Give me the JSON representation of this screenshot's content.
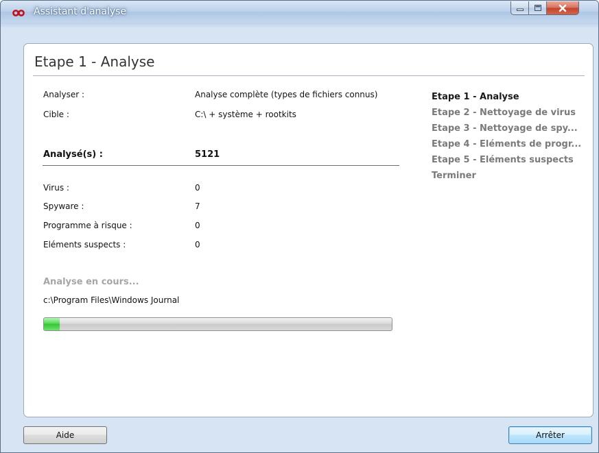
{
  "window": {
    "title": "Assistant d'analyse"
  },
  "icons": {
    "app_logo": "infinity-logo-icon",
    "minimize": "minimize-icon",
    "maximize": "maximize-icon",
    "close": "close-icon"
  },
  "colors": {
    "logo": "#c0101a",
    "progress": "#44cc44",
    "close_button": "#c8452c"
  },
  "main": {
    "heading": "Etape 1 - Analyse",
    "scan_label": "Analyser :",
    "scan_value": "Analyse complète (types de fichiers connus)",
    "target_label": "Cible :",
    "target_value": "C:\\  + système + rootkits",
    "scanned_label": "Analysé(s) :",
    "scanned_value": "5121",
    "results": [
      {
        "label": "Virus :",
        "value": "0"
      },
      {
        "label": "Spyware :",
        "value": "7"
      },
      {
        "label": "Programme à risque :",
        "value": "0"
      },
      {
        "label": "Eléments suspects :",
        "value": "0"
      }
    ],
    "status": "Analyse en cours...",
    "current_path": "c:\\Program Files\\Windows Journal",
    "progress_fraction": 0.045
  },
  "steps": [
    "Etape 1 - Analyse",
    "Etape 2 - Nettoyage de virus",
    "Etape 3 - Nettoyage de spy...",
    "Etape 4 - Eléments de progr...",
    "Etape 5 - Eléments suspects",
    "Terminer"
  ],
  "active_step": 0,
  "footer": {
    "help_label": "Aide",
    "stop_label": "Arrêter"
  }
}
